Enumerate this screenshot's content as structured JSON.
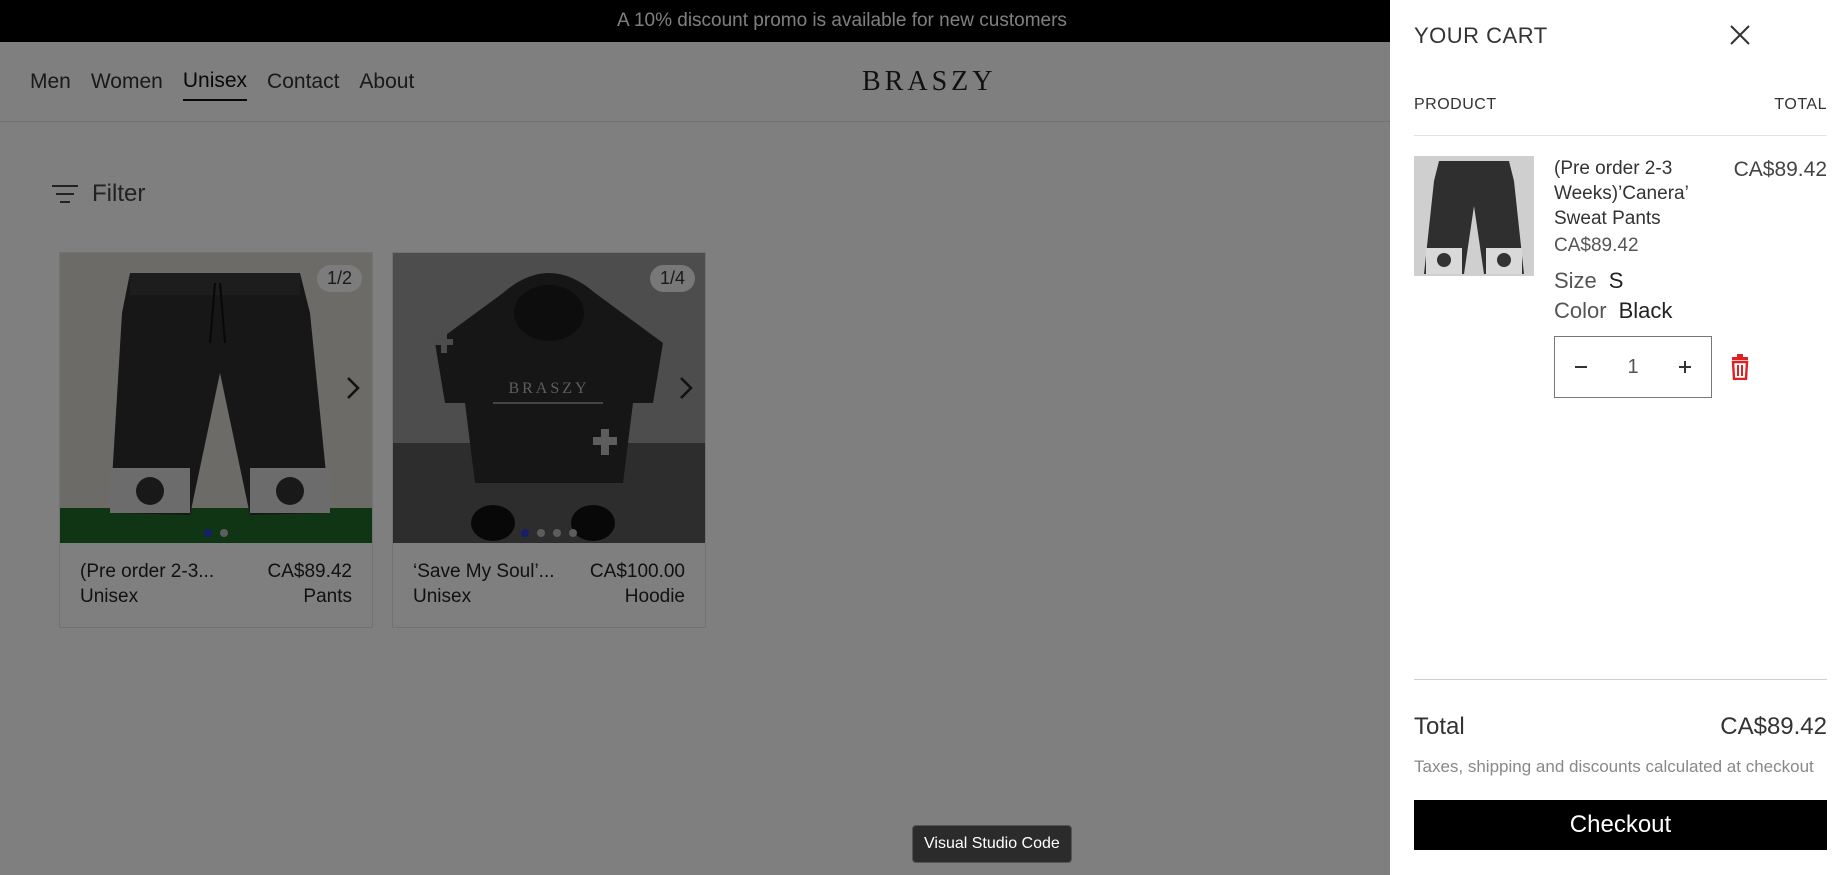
{
  "promo": {
    "text": "A 10% discount promo is available for new customers"
  },
  "nav": {
    "items": [
      {
        "label": "Men"
      },
      {
        "label": "Women"
      },
      {
        "label": "Unisex"
      },
      {
        "label": "Contact"
      },
      {
        "label": "About"
      }
    ],
    "active": "Unisex"
  },
  "brand": {
    "logo_text": "BRASZY"
  },
  "filter": {
    "label": "Filter"
  },
  "products": [
    {
      "name": "(Pre order 2-3...",
      "price": "CA$89.42",
      "gender": "Unisex",
      "category": "Pants",
      "counter": "1/2",
      "image_count": 2,
      "active_image": 1
    },
    {
      "name": "‘Save My Soul’...",
      "price": "CA$100.00",
      "gender": "Unisex",
      "category": "Hoodie",
      "counter": "1/4",
      "image_count": 4,
      "active_image": 1
    }
  ],
  "tooltip": {
    "text": "Visual Studio Code"
  },
  "cart": {
    "title": "YOUR CART",
    "col_product": "PRODUCT",
    "col_total": "TOTAL",
    "item": {
      "name": "(Pre order 2-3 Weeks)’Canera’ Sweat Pants",
      "unit_price": "CA$89.42",
      "line_total": "CA$89.42",
      "size_label": "Size",
      "size_value": "S",
      "color_label": "Color",
      "color_value": "Black",
      "quantity": "1"
    },
    "total_label": "Total",
    "total_value": "CA$89.42",
    "tax_note": "Taxes, shipping and discounts calculated at checkout",
    "checkout_label": "Checkout"
  },
  "colors": {
    "accent_dot": "#2b3fd6",
    "delete_red": "#e02020",
    "overlay": "rgba(0,0,0,0.5)"
  }
}
